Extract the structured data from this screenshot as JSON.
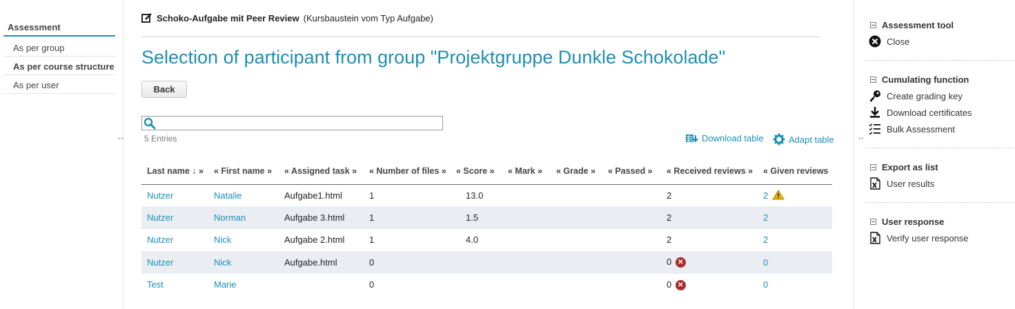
{
  "left_nav": {
    "title": "Assessment",
    "items": [
      {
        "label": "As per group",
        "active": false
      },
      {
        "label": "As per course structure",
        "active": true
      },
      {
        "label": "As per user",
        "active": false
      }
    ]
  },
  "breadcrumb": {
    "node_name": "Schoko-Aufgabe mit Peer Review",
    "node_type": "(Kursbaustein vom Typ Aufgabe)"
  },
  "page_title": "Selection of participant from group \"Projektgruppe Dunkle Schokolade\"",
  "back_label": "Back",
  "search": {
    "value": "",
    "placeholder": ""
  },
  "entries_label": "5 Entries",
  "download_table_label": "Download table",
  "adapt_table_label": "Adapt table",
  "table": {
    "headers": [
      "Last name ↓ »",
      "« First name »",
      "« Assigned task »",
      "« Number of files »",
      "« Score »",
      "« Mark »",
      "« Grade »",
      "« Passed »",
      "« Received reviews »",
      "« Given reviews"
    ],
    "rows": [
      {
        "last": "Nutzer",
        "first": "Natalie",
        "task": "Aufgabe1.html",
        "files": "1",
        "score": "13.0",
        "mark": "",
        "grade": "",
        "passed": "",
        "received": "2",
        "given": "2"
      },
      {
        "last": "Nutzer",
        "first": "Norman",
        "task": "Aufgabe 3.html",
        "files": "1",
        "score": "1.5",
        "mark": "",
        "grade": "",
        "passed": "",
        "received": "2",
        "given": "2"
      },
      {
        "last": "Nutzer",
        "first": "Nick",
        "task": "Aufgabe 2.html",
        "files": "1",
        "score": "4.0",
        "mark": "",
        "grade": "",
        "passed": "",
        "received": "2",
        "given": "2"
      },
      {
        "last": "Nutzer",
        "first": "Nick",
        "task": "Aufgabe.html",
        "files": "0",
        "score": "",
        "mark": "",
        "grade": "",
        "passed": "",
        "received": "0",
        "given": "0"
      },
      {
        "last": "Test",
        "first": "Marie",
        "task": "",
        "files": "0",
        "score": "",
        "mark": "",
        "grade": "",
        "passed": "",
        "received": "0",
        "given": "0"
      }
    ]
  },
  "right_nav": {
    "assessment_tool": {
      "title": "Assessment tool",
      "close": "Close"
    },
    "cumulating": {
      "title": "Cumulating function",
      "grading_key": "Create grading key",
      "download_certs": "Download certificates",
      "bulk": "Bulk Assessment"
    },
    "export": {
      "title": "Export as list",
      "user_results": "User results"
    },
    "user_response": {
      "title": "User response",
      "verify": "Verify user response"
    }
  },
  "colors": {
    "accent": "#1d8fb4",
    "row_alt": "#eaeef3",
    "error": "#a82e2e",
    "warning": "#f0b400"
  }
}
